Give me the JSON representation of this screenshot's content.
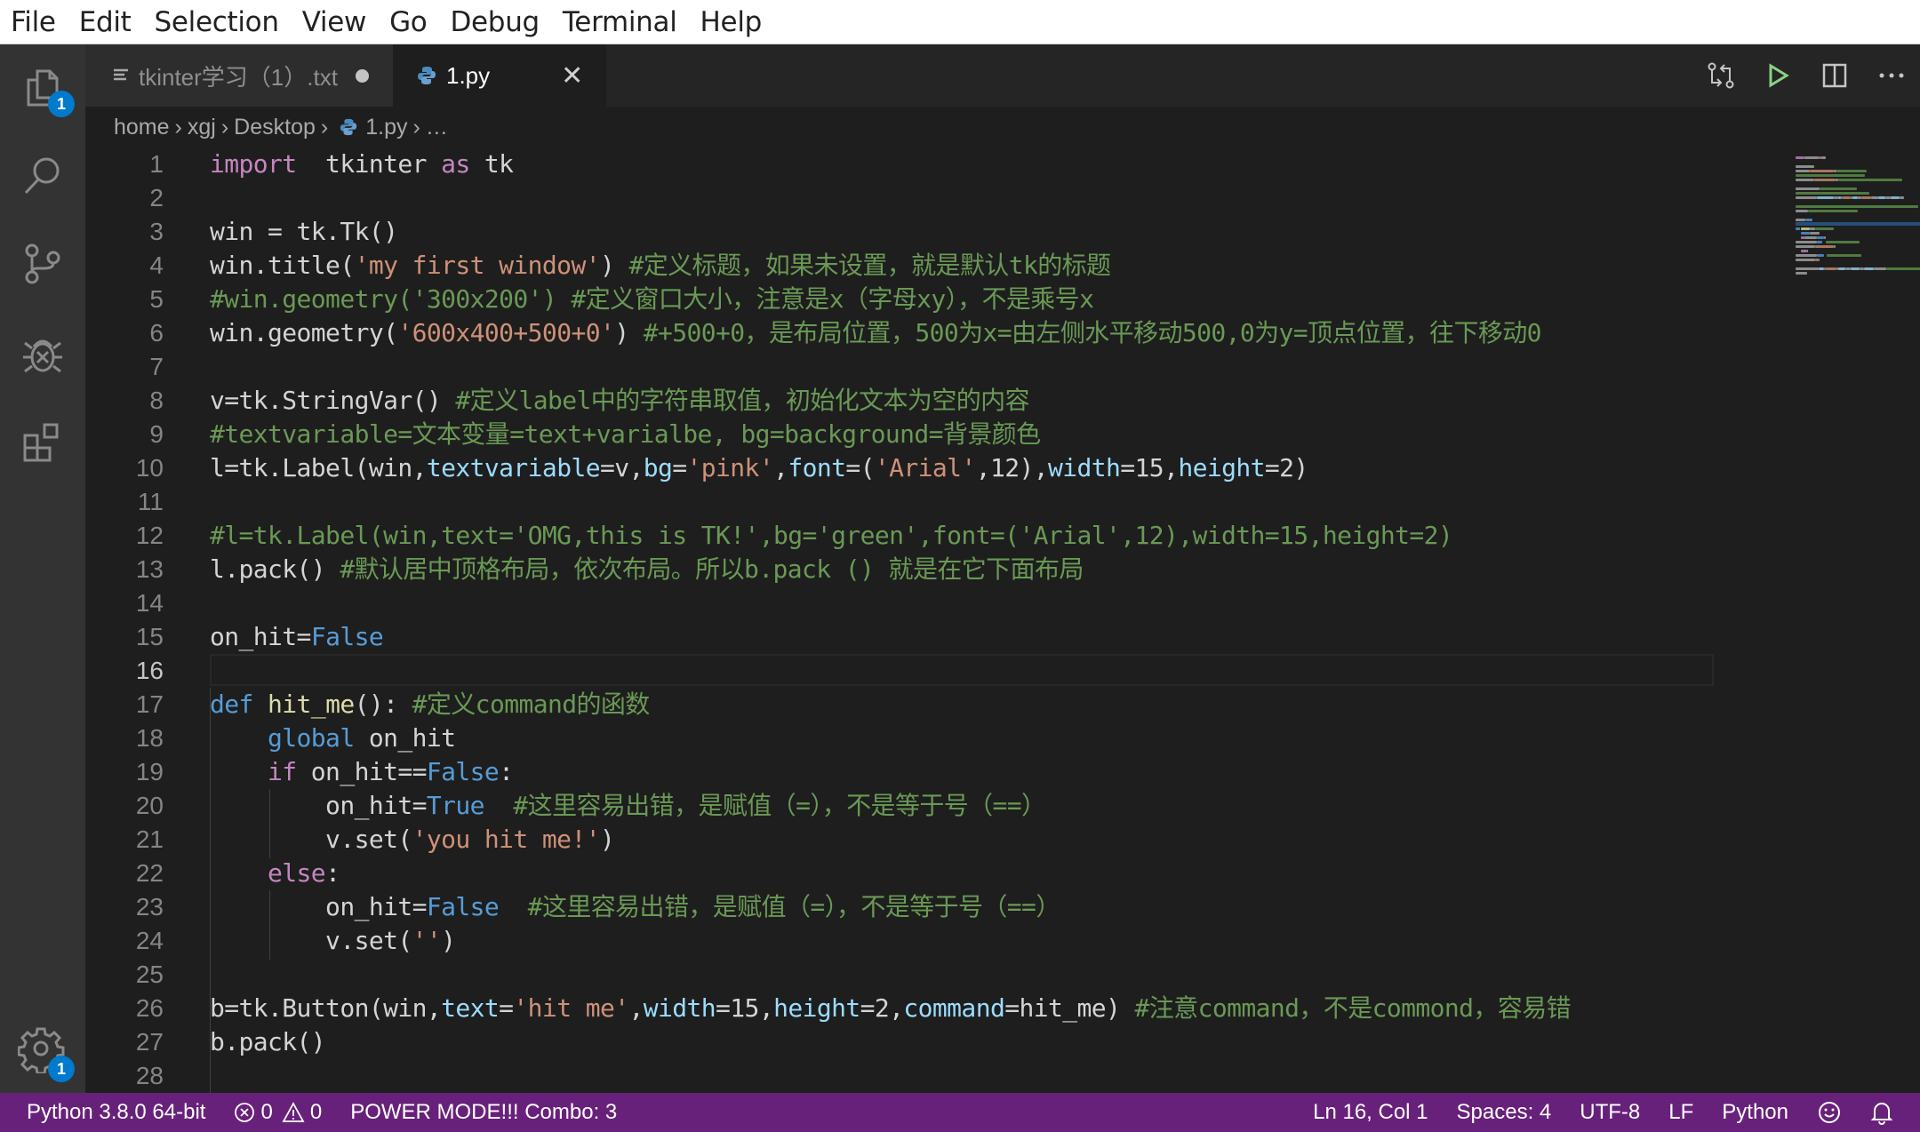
{
  "menu": [
    "File",
    "Edit",
    "Selection",
    "View",
    "Go",
    "Debug",
    "Terminal",
    "Help"
  ],
  "activity_bar": {
    "items": [
      {
        "name": "explorer",
        "icon": "files-icon",
        "badge": "1"
      },
      {
        "name": "search",
        "icon": "search-icon"
      },
      {
        "name": "source-control",
        "icon": "source-control-icon"
      },
      {
        "name": "debug",
        "icon": "debug-icon"
      },
      {
        "name": "extensions",
        "icon": "extensions-icon"
      }
    ],
    "settings_badge": "1"
  },
  "tabs": [
    {
      "label": "tkinter学习（1）.txt",
      "icon": "text-file-icon",
      "dirty": true,
      "active": false
    },
    {
      "label": "1.py",
      "icon": "python-icon",
      "dirty": false,
      "active": true,
      "close": "✕"
    }
  ],
  "editor_actions": [
    "open-changes-icon",
    "run-icon",
    "split-editor-icon",
    "more-actions-icon"
  ],
  "breadcrumb": [
    "home",
    "xgj",
    "Desktop",
    "1.py",
    "…"
  ],
  "editor": {
    "current_line": 16,
    "lines": [
      {
        "n": "1",
        "tokens": [
          [
            "k",
            "import"
          ],
          [
            "",
            "  tkinter "
          ],
          [
            "k",
            "as"
          ],
          [
            "",
            " tk"
          ]
        ]
      },
      {
        "n": "2",
        "tokens": []
      },
      {
        "n": "3",
        "tokens": [
          [
            "",
            "win = tk.Tk()"
          ]
        ]
      },
      {
        "n": "4",
        "tokens": [
          [
            "",
            "win.title("
          ],
          [
            "s",
            "'my first window'"
          ],
          [
            "",
            ") "
          ],
          [
            "c",
            "#定义标题，如果未设置，就是默认tk的标题"
          ]
        ]
      },
      {
        "n": "5",
        "tokens": [
          [
            "c",
            "#win.geometry('300x200') #定义窗口大小，注意是x（字母xy），不是乘号x"
          ]
        ]
      },
      {
        "n": "6",
        "tokens": [
          [
            "",
            "win.geometry("
          ],
          [
            "s",
            "'600x400+500+0'"
          ],
          [
            "",
            ") "
          ],
          [
            "c",
            "#+500+0，是布局位置，500为x=由左侧水平移动500,0为y=顶点位置，往下移动0"
          ]
        ]
      },
      {
        "n": "7",
        "tokens": []
      },
      {
        "n": "8",
        "tokens": [
          [
            "",
            "v=tk.StringVar() "
          ],
          [
            "c",
            "#定义label中的字符串取值，初始化文本为空的内容"
          ]
        ]
      },
      {
        "n": "9",
        "tokens": [
          [
            "c",
            "#textvariable=文本变量=text+varialbe, bg=background=背景颜色"
          ]
        ]
      },
      {
        "n": "10",
        "tokens": [
          [
            "",
            "l=tk.Label(win,"
          ],
          [
            "p",
            "textvariable"
          ],
          [
            "",
            "=v,"
          ],
          [
            "p",
            "bg"
          ],
          [
            "",
            "="
          ],
          [
            "s",
            "'pink'"
          ],
          [
            "",
            ","
          ],
          [
            "p",
            "font"
          ],
          [
            "",
            "=("
          ],
          [
            "s",
            "'Arial'"
          ],
          [
            "",
            ",12),"
          ],
          [
            "p",
            "width"
          ],
          [
            "",
            "=15,"
          ],
          [
            "p",
            "height"
          ],
          [
            "",
            "=2)"
          ]
        ]
      },
      {
        "n": "11",
        "tokens": []
      },
      {
        "n": "12",
        "tokens": [
          [
            "c",
            "#l=tk.Label(win,text='OMG,this is TK!',bg='green',font=('Arial',12),width=15,height=2)"
          ]
        ]
      },
      {
        "n": "13",
        "tokens": [
          [
            "",
            "l.pack() "
          ],
          [
            "c",
            "#默认居中顶格布局，依次布局。所以b.pack () 就是在它下面布局"
          ]
        ]
      },
      {
        "n": "14",
        "tokens": []
      },
      {
        "n": "15",
        "tokens": [
          [
            "",
            "on_hit="
          ],
          [
            "kb",
            "False"
          ]
        ]
      },
      {
        "n": "16",
        "tokens": []
      },
      {
        "n": "17",
        "tokens": [
          [
            "kb",
            "def"
          ],
          [
            "",
            " "
          ],
          [
            "f",
            "hit_me"
          ],
          [
            "",
            "(): "
          ],
          [
            "c",
            "#定义command的函数"
          ]
        ]
      },
      {
        "n": "18",
        "tokens": [
          [
            "",
            "    "
          ],
          [
            "kb",
            "global"
          ],
          [
            "",
            " on_hit"
          ]
        ]
      },
      {
        "n": "19",
        "tokens": [
          [
            "",
            "    "
          ],
          [
            "k",
            "if"
          ],
          [
            "",
            " on_hit=="
          ],
          [
            "kb",
            "False"
          ],
          [
            "",
            ":"
          ]
        ]
      },
      {
        "n": "20",
        "tokens": [
          [
            "",
            "        on_hit="
          ],
          [
            "kb",
            "True"
          ],
          [
            "",
            "  "
          ],
          [
            "c",
            "#这里容易出错，是赋值（=），不是等于号（==）"
          ]
        ]
      },
      {
        "n": "21",
        "tokens": [
          [
            "",
            "        v.set("
          ],
          [
            "s",
            "'you hit me!'"
          ],
          [
            "",
            ")"
          ]
        ]
      },
      {
        "n": "22",
        "tokens": [
          [
            "",
            "    "
          ],
          [
            "k",
            "else"
          ],
          [
            "",
            ":"
          ]
        ]
      },
      {
        "n": "23",
        "tokens": [
          [
            "",
            "        on_hit="
          ],
          [
            "kb",
            "False"
          ],
          [
            "",
            "  "
          ],
          [
            "c",
            "#这里容易出错，是赋值（=），不是等于号（==）"
          ]
        ]
      },
      {
        "n": "24",
        "tokens": [
          [
            "",
            "        v.set("
          ],
          [
            "s",
            "''"
          ],
          [
            "",
            ")"
          ]
        ]
      },
      {
        "n": "25",
        "tokens": []
      },
      {
        "n": "26",
        "tokens": [
          [
            "",
            "b=tk.Button(win,"
          ],
          [
            "p",
            "text"
          ],
          [
            "",
            "="
          ],
          [
            "s",
            "'hit me'"
          ],
          [
            "",
            ","
          ],
          [
            "p",
            "width"
          ],
          [
            "",
            "=15,"
          ],
          [
            "p",
            "height"
          ],
          [
            "",
            "=2,"
          ],
          [
            "p",
            "command"
          ],
          [
            "",
            "=hit_me) "
          ],
          [
            "c",
            "#注意command，不是commond，容易错"
          ]
        ]
      },
      {
        "n": "27",
        "tokens": [
          [
            "",
            "b.pack()"
          ]
        ]
      },
      {
        "n": "28",
        "tokens": []
      }
    ]
  },
  "status_bar": {
    "interpreter": "Python 3.8.0 64-bit",
    "errors": "0",
    "warnings": "0",
    "power_mode": "POWER MODE!!! Combo: 3",
    "cursor": "Ln 16, Col 1",
    "indent": "Spaces: 4",
    "encoding": "UTF-8",
    "eol": "LF",
    "language": "Python"
  },
  "colors": {
    "status_bar": "#68217a",
    "accent": "#007acc",
    "run": "#89d185"
  }
}
